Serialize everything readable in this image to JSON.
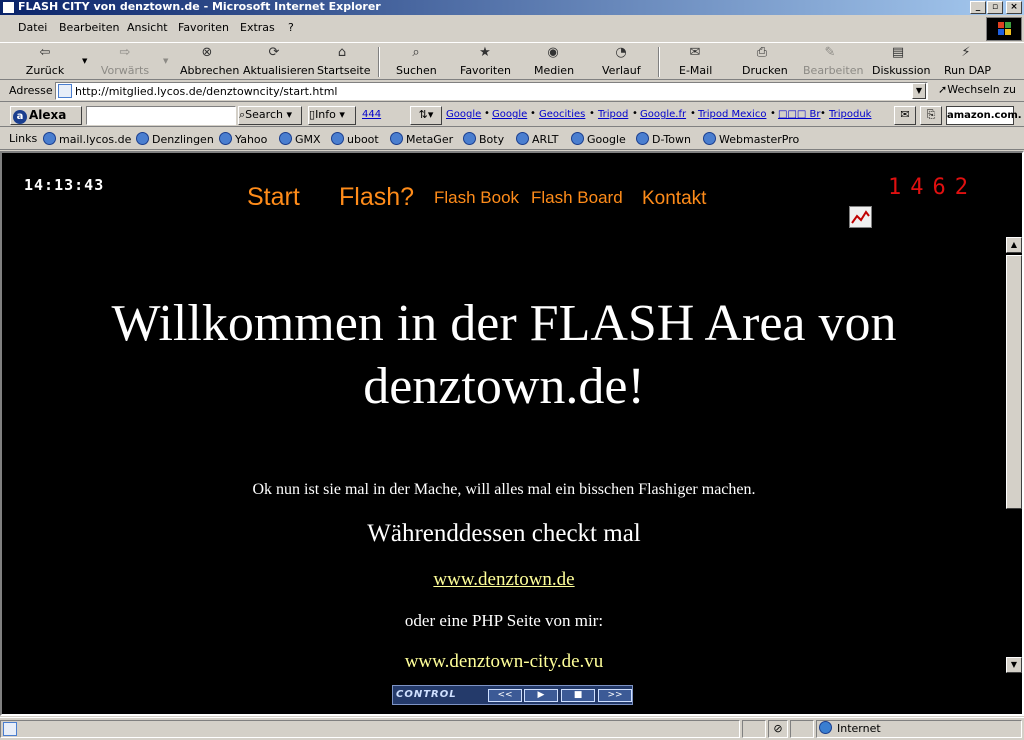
{
  "window": {
    "title": "FLASH CITY von denztown.de - Microsoft Internet Explorer"
  },
  "menu": [
    "Datei",
    "Bearbeiten",
    "Ansicht",
    "Favoriten",
    "Extras",
    "?"
  ],
  "toolbar": {
    "back": "Zurück",
    "forward": "Vorwärts",
    "stop": "Abbrechen",
    "refresh": "Aktualisieren",
    "home": "Startseite",
    "search": "Suchen",
    "favorites": "Favoriten",
    "media": "Medien",
    "history": "Verlauf",
    "mail": "E-Mail",
    "print": "Drucken",
    "edit": "Bearbeiten",
    "discuss": "Diskussion",
    "rundap": "Run DAP"
  },
  "address": {
    "label": "Adresse",
    "url": "http://mitglied.lycos.de/denztowncity/start.html",
    "go": "Wechseln zu"
  },
  "alexa": {
    "brand": "Alexa",
    "search_value": "",
    "search_btn": "Search",
    "info_btn": "Info",
    "count": "444",
    "links": [
      "Google",
      "Google",
      "Geocities",
      "Tripod",
      "Google.fr",
      "Tripod Mexico",
      "□□□ Br",
      "Tripoduk"
    ],
    "amazon": "amazon.com."
  },
  "links": {
    "label": "Links",
    "items": [
      "mail.lycos.de",
      "Denzlingen",
      "Yahoo",
      "GMX",
      "uboot",
      "MetaGer",
      "Boty",
      "ARLT",
      "Google",
      "D-Town",
      "WebmasterPro"
    ]
  },
  "page": {
    "clock": "14:13:43",
    "nav": {
      "start": "Start",
      "flash": "Flash?",
      "flashbook": "Flash Book",
      "flashboard": "Flash Board",
      "kontakt": "Kontakt"
    },
    "counter": "1462",
    "heading_line1": "Willkommen in der FLASH Area von",
    "heading_line2": "denztown.de!",
    "intro": "Ok nun ist sie mal in der Mache, will alles mal ein bisschen Flashiger machen.",
    "meanwhile": "Währenddessen checkt mal",
    "link1": "www.denztown.de",
    "php": "oder eine PHP Seite von mir:",
    "link2": "www.denztown-city.de.vu",
    "control": {
      "label": "CONTROL",
      "prev": "<<",
      "play": "▶",
      "stop": "■",
      "next": ">>"
    }
  },
  "status": {
    "zone": "Internet"
  },
  "colors": {
    "nav": "#ff8c1a",
    "counter": "#e01010",
    "link": "#ffff99",
    "background": "#000000"
  }
}
